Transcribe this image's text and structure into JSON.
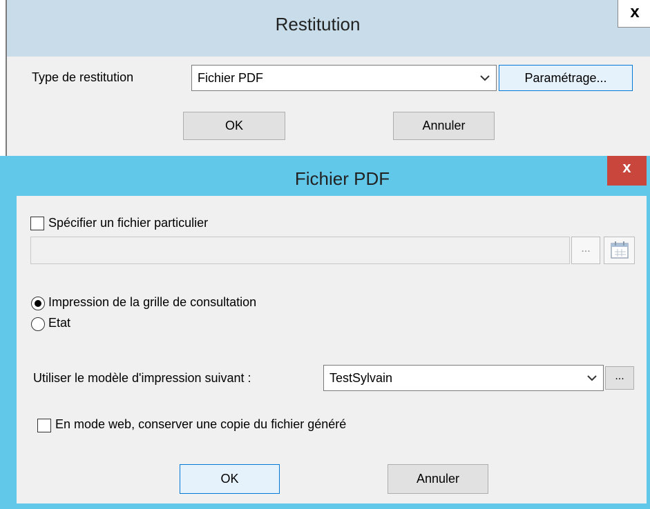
{
  "restitution_dialog": {
    "title": "Restitution",
    "close_glyph": "x",
    "type_label": "Type de restitution",
    "type_value": "Fichier PDF",
    "settings_button": "Paramétrage...",
    "ok_button": "OK",
    "cancel_button": "Annuler"
  },
  "pdf_dialog": {
    "title": "Fichier PDF",
    "close_glyph": "x",
    "specify_file_label": "Spécifier un fichier particulier",
    "specify_file_checked": false,
    "file_path_value": "",
    "browse_glyph": "...",
    "calendar_icon": "calendar-icon",
    "radio_options": [
      {
        "label": "Impression de la grille de consultation",
        "selected": true
      },
      {
        "label": "Etat",
        "selected": false
      }
    ],
    "template_label": "Utiliser le modèle d'impression suivant :",
    "template_value": "TestSylvain",
    "template_browse": "...",
    "web_copy_label": "En mode web, conserver une copie du fichier généré",
    "web_copy_checked": false,
    "ok_button": "OK",
    "cancel_button": "Annuler"
  },
  "colors": {
    "active_titlebar": "#62c8ea",
    "inactive_titlebar": "#c8dde9",
    "close_active": "#c9463d",
    "dialog_bg": "#f0f0f0"
  }
}
